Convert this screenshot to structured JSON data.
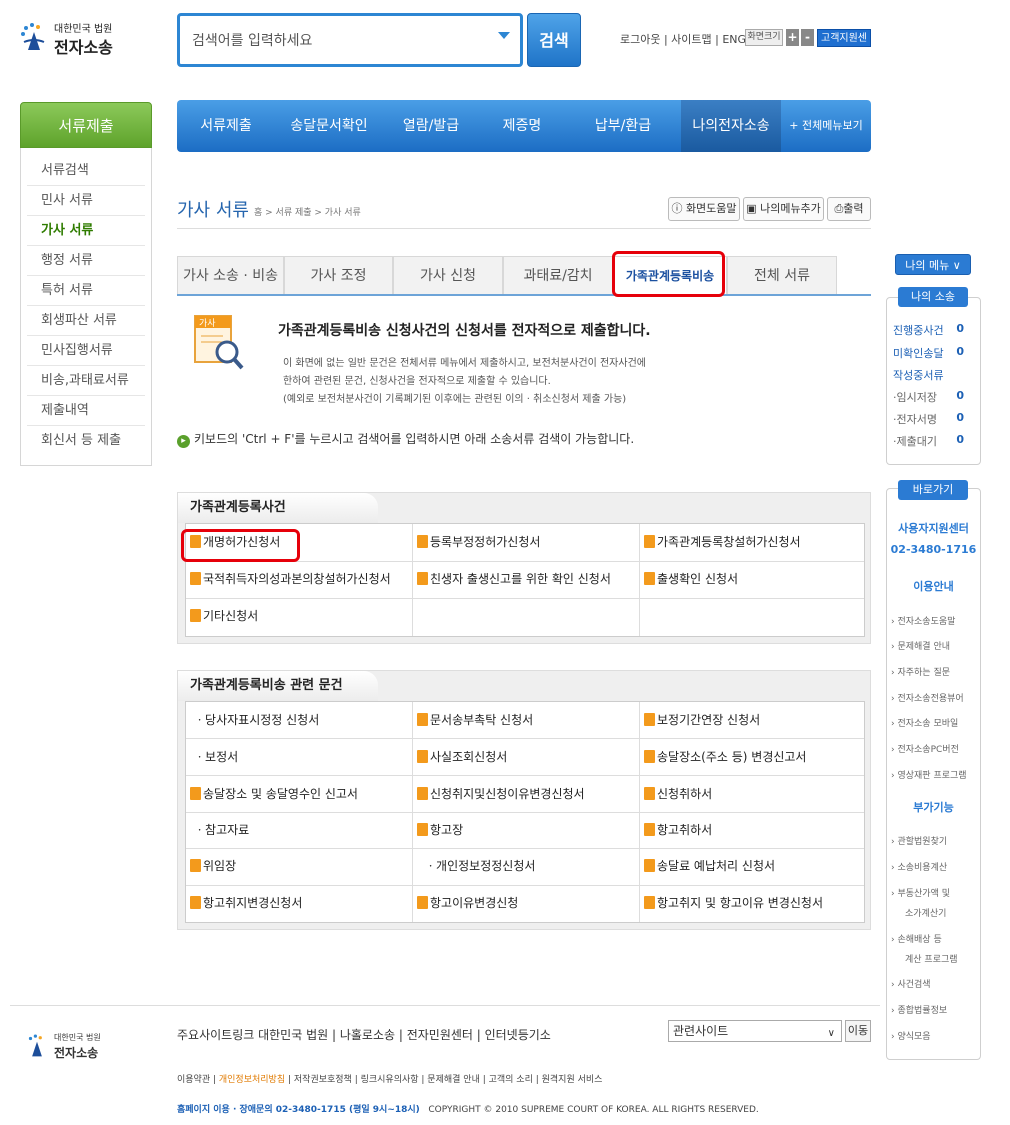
{
  "header": {
    "logo_line1": "대한민국 법원",
    "logo_line2": "전자소송",
    "search_placeholder": "검색어를 입력하세요",
    "search_button": "검색",
    "top_links": "로그아웃 | 사이트맵 | ENGLISH",
    "font_size_label": "화면크기",
    "font_plus": "+",
    "font_minus": "-",
    "support_center": "고객지원센터"
  },
  "left_nav": {
    "title": "서류제출",
    "items": [
      "서류검색",
      "민사 서류",
      "가사 서류",
      "행정 서류",
      "특허 서류",
      "회생파산 서류",
      "민사집행서류",
      "비송,과태료서류",
      "제출내역",
      "회신서 등 제출"
    ],
    "active": "가사 서류"
  },
  "global_nav": {
    "items": [
      "서류제출",
      "송달문서확인",
      "열람/발급",
      "제증명",
      "납부/환급",
      "나의전자소송",
      "+ 전체메뉴보기"
    ],
    "active": "나의전자소송"
  },
  "page": {
    "title": "가사 서류",
    "breadcrumb": "홈 > 서류 제출 > 가사 서류",
    "help_button": "화면도움말",
    "mymenu_add_button": "나의메뉴추가",
    "print_button": "출력"
  },
  "tabs": {
    "items": [
      "가사 소송 · 비송",
      "가사 조정",
      "가사 신청",
      "과태료/감치",
      "가족관계등록비송",
      "전체 서류"
    ],
    "active": "가족관계등록비송"
  },
  "intro": {
    "icon_label": "가사",
    "headline": "가족관계등록비송 신청사건의 신청서를 전자적으로 제출합니다.",
    "line1": "이 화면에 없는 일반 문건은 전체서류 메뉴에서 제출하시고, 보전처분사건이 전자사건에",
    "line2": "한하여 관련된 문건, 신청사건을 전자적으로 제출할 수 있습니다.",
    "line3": "(예외로 보전처분사건이 기록폐기된 이후에는 관련된 이의 · 취소신청서 제출 가능)",
    "keyboard_tip": "키보드의 'Ctrl + F'를 누르시고 검색어를 입력하시면 아래 소송서류 검색이 가능합니다."
  },
  "section1": {
    "title": "가족관계등록사건",
    "rows": [
      [
        "개명허가신청서",
        "등록부정정허가신청서",
        "가족관계등록창설허가신청서"
      ],
      [
        "국적취득자의성과본의창설허가신청서",
        "친생자 출생신고를 위한 확인 신청서",
        "출생확인 신청서"
      ],
      [
        "기타신청서",
        "",
        ""
      ]
    ]
  },
  "section2": {
    "title": "가족관계등록비송 관련 문건",
    "rows": [
      [
        "ㆍ당사자표시정정 신청서",
        "문서송부촉탁 신청서",
        "보정기간연장 신청서"
      ],
      [
        "ㆍ보정서",
        "사실조회신청서",
        "송달장소(주소 등) 변경신고서"
      ],
      [
        "송달장소 및 송달영수인 신고서",
        "신청취지및신청이유변경신청서",
        "신청취하서"
      ],
      [
        "ㆍ참고자료",
        "항고장",
        "항고취하서"
      ],
      [
        "위임장",
        "ㆍ개인정보정정신청서",
        "송달료 예납처리 신청서"
      ],
      [
        "항고취지변경신청서",
        "항고이유변경신청",
        "항고취지 및 항고이유 변경신청서"
      ]
    ]
  },
  "right_panel": {
    "mymenu_button": "나의 메뉴 ∨",
    "mycase_title": "나의 소송",
    "mycase_items": [
      {
        "label": "진행중사건",
        "value": "0"
      },
      {
        "label": "미확인송달",
        "value": "0"
      },
      {
        "label": "작성중서류",
        "value": ""
      },
      {
        "label": "·임시저장",
        "value": "0"
      },
      {
        "label": "·전자서명",
        "value": "0"
      },
      {
        "label": "·제출대기",
        "value": "0"
      }
    ],
    "quick_title": "바로가기",
    "support_label": "사용자지원센터",
    "support_phone": "02-3480-1716",
    "guide_title": "이용안내",
    "guide_items": [
      "› 전자소송도움말",
      "› 문제해결 안내",
      "› 자주하는 질문",
      "› 전자소송전용뷰어",
      "› 전자소송 모바일",
      "› 전자소송PC버전",
      "› 영상재판 프로그램"
    ],
    "extra_title": "부가기능",
    "extra_items": [
      "› 관할법원찾기",
      "› 소송비용계산",
      "› 부동산가액 및",
      "소가계산기",
      "› 손해배상 등",
      "계산 프로그램",
      "› 사건검색",
      "› 종합법률정보",
      "› 양식모음"
    ]
  },
  "footer": {
    "logo_line1": "대한민국 법원",
    "logo_line2": "전자소송",
    "links": "주요사이트링크   대한민국 법원  |  나홀로소송  |  전자민원센터  |  인터넷등기소",
    "related_select": "관련사이트",
    "go_button": "이동",
    "links2_a": "이용약관 | ",
    "links2_b": "개인정보처리방침",
    "links2_c": " | 저작권보호정책 | 링크시유의사항 | 문제해결 안내 | 고객의 소리 | 원격지원 서비스",
    "contact": "홈페이지 이용 · 장애문의 02-3480-1715 (평일 9시~18시)",
    "copyright": "COPYRIGHT © 2010 SUPREME COURT OF KOREA. ALL RIGHTS RESERVED."
  },
  "colors": {
    "brand_blue": "#1c6dc4",
    "nav_green": "#5ea32b",
    "highlight_red": "#e6000a",
    "doc_icon": "#f39a1c"
  },
  "icons": [
    "court-logo-icon",
    "dropdown-arrow-icon",
    "help-icon",
    "mymenu-icon",
    "print-icon",
    "document-magnifier-icon",
    "info-circle-icon",
    "document-icon"
  ]
}
